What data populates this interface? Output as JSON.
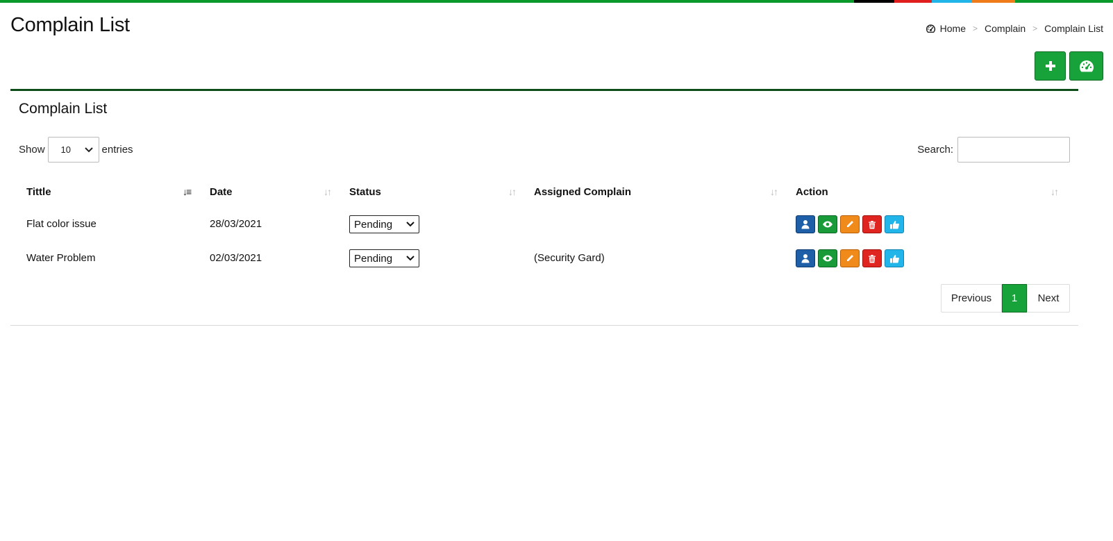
{
  "colors": {
    "stripe": [
      "#0a9a2b",
      "#000000",
      "#e01e1e",
      "#22b5ea",
      "#f07b1a",
      "#0a9a2b"
    ],
    "primary_green": "#18a33a",
    "panel_border": "#0d4d1a",
    "action_blue": "#1f5fa8",
    "action_green": "#1a9b3a",
    "action_orange": "#f08a1a",
    "action_red": "#e0241f",
    "action_lightblue": "#22b5ea"
  },
  "header": {
    "title": "Complain List"
  },
  "breadcrumb": {
    "icon": "dashboard-icon",
    "items": [
      "Home",
      "Complain",
      "Complain List"
    ]
  },
  "toolbar": {
    "add_icon": "plus-icon",
    "dashboard_icon": "dashboard-icon"
  },
  "panel": {
    "title": "Complain List",
    "show_label": "Show",
    "entries_value": "10",
    "entries_label": "entries",
    "search_label": "Search:",
    "search_value": ""
  },
  "table": {
    "columns": [
      "Tittle",
      "Date",
      "Status",
      "Assigned Complain",
      "Action"
    ],
    "rows": [
      {
        "title": "Flat color issue",
        "date": "28/03/2021",
        "status": "Pending",
        "assigned": ""
      },
      {
        "title": "Water Problem",
        "date": "02/03/2021",
        "status": "Pending",
        "assigned": "(Security Gard)"
      }
    ],
    "action_icons": [
      "user-icon",
      "eye-icon",
      "pencil-icon",
      "trash-icon",
      "thumbs-up-icon"
    ]
  },
  "pagination": {
    "previous": "Previous",
    "current": "1",
    "next": "Next"
  }
}
